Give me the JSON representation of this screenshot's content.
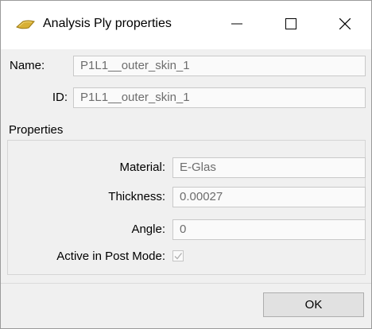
{
  "window": {
    "title": "Analysis Ply properties",
    "icon": "ply-icon",
    "accent_color": "#d8b035"
  },
  "header_fields": {
    "name_label": "Name:",
    "name_value": "P1L1__outer_skin_1",
    "id_label": "ID:",
    "id_value": "P1L1__outer_skin_1"
  },
  "properties": {
    "group_title": "Properties",
    "material_label": "Material:",
    "material_value": "E-Glas",
    "thickness_label": "Thickness:",
    "thickness_value": "0.00027",
    "angle_label": "Angle:",
    "angle_value": "0",
    "active_label": "Active in Post Mode:",
    "active_checked": true
  },
  "footer": {
    "ok_label": "OK"
  }
}
